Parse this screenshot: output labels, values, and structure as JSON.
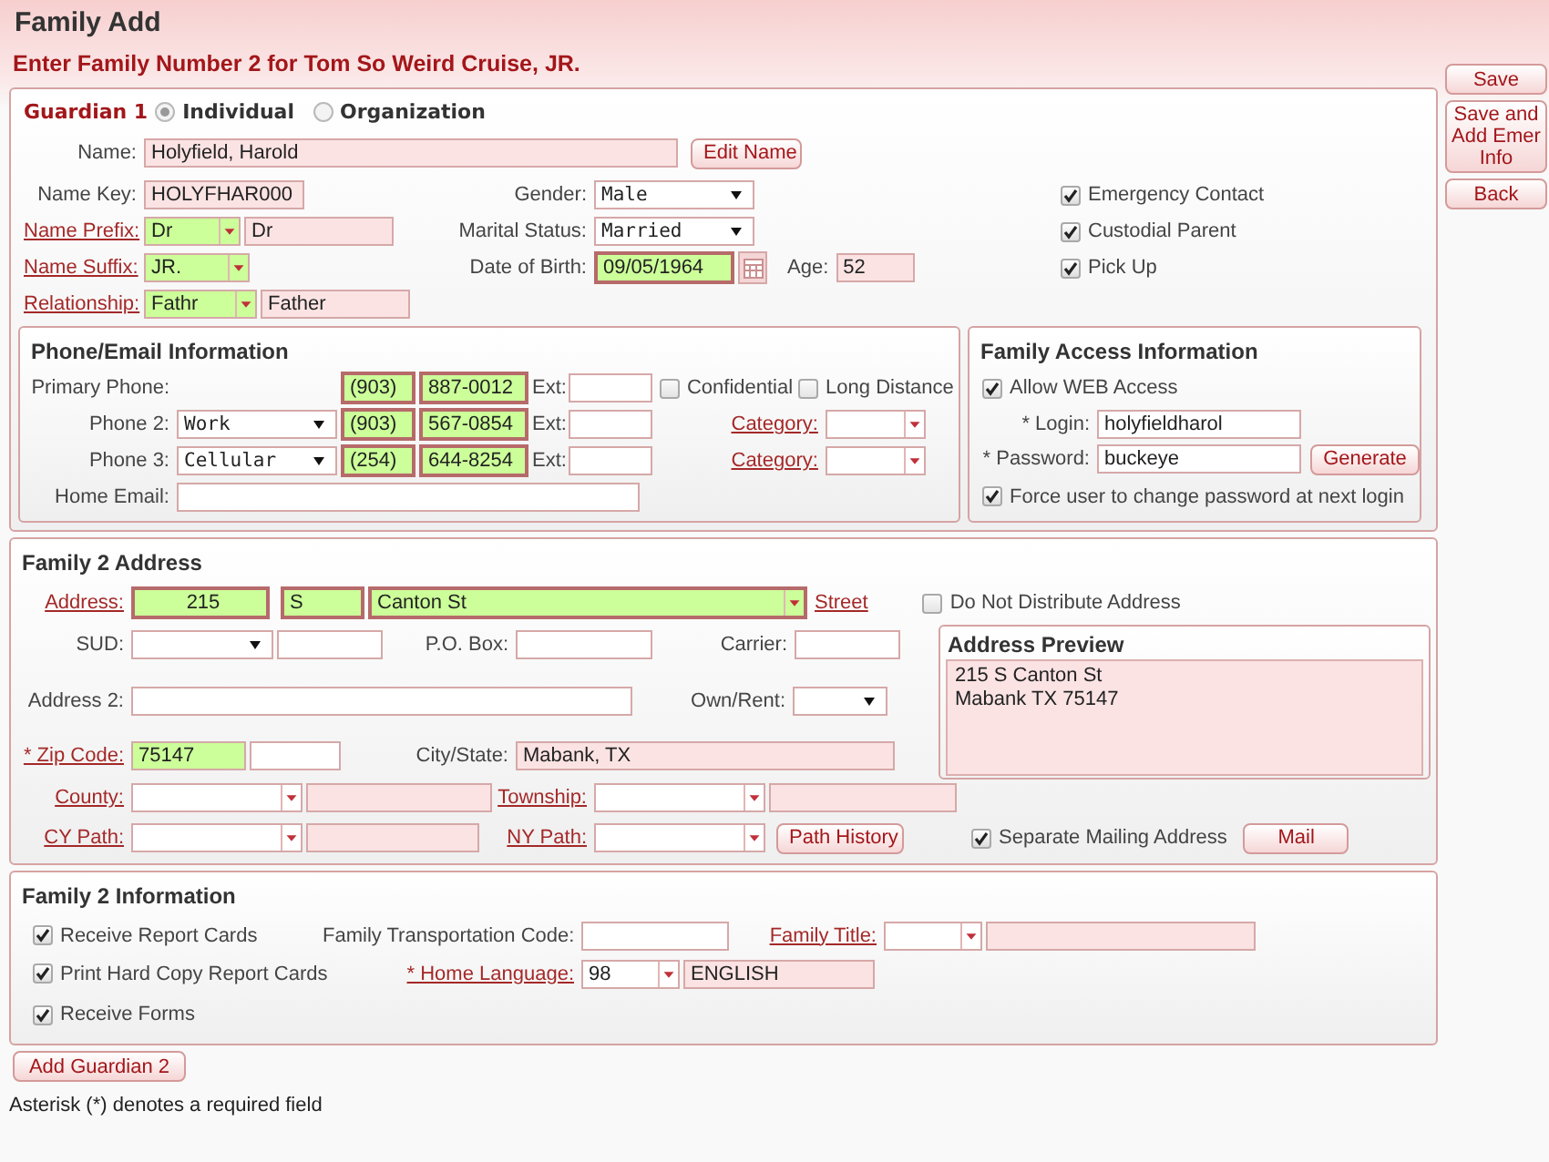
{
  "page_title": "Family Add",
  "heading": "Enter Family Number 2 for Tom So Weird Cruise, JR.",
  "actions": [
    {
      "label": "Save"
    },
    {
      "label": "Save and Add Emer Info"
    },
    {
      "label": "Back"
    }
  ],
  "guardian": {
    "title": "Guardian 1",
    "types": [
      {
        "label": "Individual",
        "selected": true
      },
      {
        "label": "Organization",
        "selected": false
      }
    ],
    "name": {
      "label": "Name:",
      "link": false,
      "fields": [
        {
          "kind": "text",
          "color": "#fbe3e3",
          "value": "Holyfield, Harold"
        }
      ]
    },
    "edit_button": "Edit Name",
    "left_rows": [
      {
        "label": "Name Key:",
        "link": false,
        "fields": [
          {
            "kind": "text",
            "color": "#fbe3e3",
            "value": "HOLYFHAR000"
          }
        ]
      },
      {
        "label": "Name Prefix:",
        "link": true,
        "fields": [
          {
            "kind": "combo",
            "color": "#ccff99",
            "value": "Dr"
          },
          {
            "kind": "text",
            "color": "#fbe3e3",
            "value": "Dr"
          }
        ]
      },
      {
        "label": "Name Suffix:",
        "link": true,
        "fields": [
          {
            "kind": "combo",
            "color": "#ccff99",
            "value": "JR."
          }
        ]
      },
      {
        "label": "Relationship:",
        "link": true,
        "fields": [
          {
            "kind": "combo",
            "color": "#ccff99",
            "value": "Fathr"
          },
          {
            "kind": "text",
            "color": "#fbe3e3",
            "value": "Father"
          }
        ]
      }
    ],
    "middle_rows": [
      {
        "label": "Gender:",
        "link": false,
        "fields": [
          {
            "kind": "select",
            "color": "#ffffff",
            "value": "Male"
          }
        ]
      },
      {
        "label": "Marital Status:",
        "link": false,
        "fields": [
          {
            "kind": "select",
            "color": "#ffffff",
            "value": "Married"
          }
        ]
      },
      {
        "label": "Date of Birth:",
        "link": false,
        "fields": [
          {
            "kind": "date",
            "color": "#ccff99",
            "value": "09/05/1964"
          }
        ]
      }
    ],
    "age": {
      "label": "Age:",
      "link": false,
      "fields": [
        {
          "kind": "text",
          "color": "#fbe3e3",
          "value": "52"
        }
      ]
    },
    "checks": [
      {
        "label": "Emergency Contact",
        "checked": true
      },
      {
        "label": "Custodial Parent",
        "checked": true
      },
      {
        "label": "Pick Up",
        "checked": true
      }
    ]
  },
  "phone_email": {
    "title": "Phone/Email Information",
    "phones": [
      {
        "label": "Primary Phone:",
        "area": {
          "kind": "text",
          "color": "#ccff99",
          "value": "(903)"
        },
        "number": {
          "kind": "text",
          "color": "#ccff99",
          "value": "887-0012"
        },
        "ext_label": "Ext:",
        "ext": {
          "kind": "text",
          "color": "#ffffff"
        },
        "checks": [
          {
            "label": "Confidential",
            "checked": false
          },
          {
            "label": "Long Distance",
            "checked": false
          }
        ]
      },
      {
        "label": "Phone 2:",
        "type": {
          "kind": "select",
          "color": "#ffffff",
          "value": "Work"
        },
        "area": {
          "kind": "text",
          "color": "#ccff99",
          "value": "(903)"
        },
        "number": {
          "kind": "text",
          "color": "#ccff99",
          "value": "567-0854"
        },
        "ext_label": "Ext:",
        "ext": {
          "kind": "text",
          "color": "#ffffff"
        },
        "category": {
          "label": "Category:",
          "link": true,
          "field": {
            "kind": "combo",
            "color": "#ffffff"
          }
        }
      },
      {
        "label": "Phone 3:",
        "type": {
          "kind": "select",
          "color": "#ffffff",
          "value": "Cellular"
        },
        "area": {
          "kind": "text",
          "color": "#ccff99",
          "value": "(254)"
        },
        "number": {
          "kind": "text",
          "color": "#ccff99",
          "value": "644-8254"
        },
        "ext_label": "Ext:",
        "ext": {
          "kind": "text",
          "color": "#ffffff"
        },
        "category": {
          "label": "Category:",
          "link": true,
          "field": {
            "kind": "combo",
            "color": "#ffffff"
          }
        }
      }
    ],
    "email": {
      "label": "Home Email:",
      "link": false,
      "fields": [
        {
          "kind": "text",
          "color": "#ffffff"
        }
      ]
    }
  },
  "family_access": {
    "title": "Family Access Information",
    "allow_web": {
      "label": "Allow WEB Access",
      "checked": true
    },
    "login": {
      "label": "* Login:",
      "link": false,
      "fields": [
        {
          "kind": "text",
          "color": "#ffffff",
          "value": "holyfieldharol"
        }
      ]
    },
    "password": {
      "label": "* Password:",
      "link": false,
      "fields": [
        {
          "kind": "text",
          "color": "#ffffff",
          "value": "buckeye"
        }
      ]
    },
    "generate_button": "Generate",
    "force_change": {
      "label": "Force user to change password at next login",
      "checked": true
    }
  },
  "address": {
    "title": "Family 2 Address",
    "street": {
      "label": "Address:",
      "link": true,
      "fields": [
        {
          "kind": "text",
          "color": "#ccff99",
          "value": "215"
        },
        {
          "kind": "text",
          "color": "#ccff99",
          "value": "S"
        },
        {
          "kind": "combo",
          "color": "#ccff99",
          "value": "Canton St"
        }
      ]
    },
    "street_link": "Street",
    "do_not_distribute": {
      "label": "Do Not Distribute Address",
      "checked": false
    },
    "sud": {
      "label": "SUD:",
      "link": false,
      "fields": [
        {
          "kind": "select",
          "color": "#ffffff"
        },
        {
          "kind": "text",
          "color": "#ffffff"
        }
      ]
    },
    "po_box": {
      "label": "P.O. Box:",
      "link": false,
      "fields": [
        {
          "kind": "text",
          "color": "#ffffff"
        }
      ]
    },
    "carrier": {
      "label": "Carrier:",
      "link": false,
      "fields": [
        {
          "kind": "text",
          "color": "#ffffff"
        }
      ]
    },
    "address_2": {
      "label": "Address 2:",
      "link": false,
      "fields": [
        {
          "kind": "text",
          "color": "#ffffff"
        }
      ]
    },
    "own_rent": {
      "label": "Own/Rent:",
      "link": false,
      "fields": [
        {
          "kind": "select",
          "color": "#ffffff"
        }
      ]
    },
    "zip_code": {
      "label": "* Zip Code:",
      "link": true,
      "fields": [
        {
          "kind": "text",
          "color": "#ccff99",
          "value": "75147"
        },
        {
          "kind": "text",
          "color": "#ffffff"
        }
      ]
    },
    "city_state": {
      "label": "City/State:",
      "link": false,
      "fields": [
        {
          "kind": "text",
          "color": "#fbe3e3",
          "value": "Mabank, TX"
        }
      ]
    },
    "county": {
      "label": "County:",
      "link": true,
      "fields": [
        {
          "kind": "combo",
          "color": "#ffffff"
        },
        {
          "kind": "text",
          "color": "#fbe3e3"
        }
      ]
    },
    "township": {
      "label": "Township:",
      "link": true,
      "fields": [
        {
          "kind": "combo",
          "color": "#ffffff"
        },
        {
          "kind": "text",
          "color": "#fbe3e3"
        }
      ]
    },
    "cy_path": {
      "label": "CY Path:",
      "link": true,
      "fields": [
        {
          "kind": "combo",
          "color": "#ffffff"
        },
        {
          "kind": "text",
          "color": "#fbe3e3"
        }
      ]
    },
    "ny_path": {
      "label": "NY Path:",
      "link": true,
      "fields": [
        {
          "kind": "combo",
          "color": "#ffffff"
        }
      ]
    },
    "path_history_button": "Path History",
    "separate_mailing": {
      "label": "Separate Mailing Address",
      "checked": true
    },
    "mail_button": "Mail",
    "preview": {
      "title": "Address Preview",
      "lines": [
        "215 S Canton St",
        "Mabank TX 75147"
      ]
    }
  },
  "family_info": {
    "title": "Family 2 Information",
    "checks": [
      {
        "label": "Receive Report Cards",
        "checked": true
      },
      {
        "label": "Print Hard Copy Report Cards",
        "checked": true
      },
      {
        "label": "Receive Forms",
        "checked": true
      }
    ],
    "transportation": {
      "label": "Family Transportation Code:",
      "link": false,
      "fields": [
        {
          "kind": "text",
          "color": "#ffffff"
        }
      ]
    },
    "family_title": {
      "label": "Family Title:",
      "link": true,
      "fields": [
        {
          "kind": "combo",
          "color": "#ffffff"
        },
        {
          "kind": "text",
          "color": "#fbe3e3"
        }
      ]
    },
    "home_language": {
      "label": "* Home Language:",
      "link": true,
      "fields": [
        {
          "kind": "combo",
          "color": "#ffffff",
          "value": "98"
        },
        {
          "kind": "text",
          "color": "#fbe3e3",
          "value": "ENGLISH"
        }
      ]
    }
  },
  "add_guardian_button": "Add Guardian 2",
  "footnote": "Asterisk (*) denotes a required field"
}
